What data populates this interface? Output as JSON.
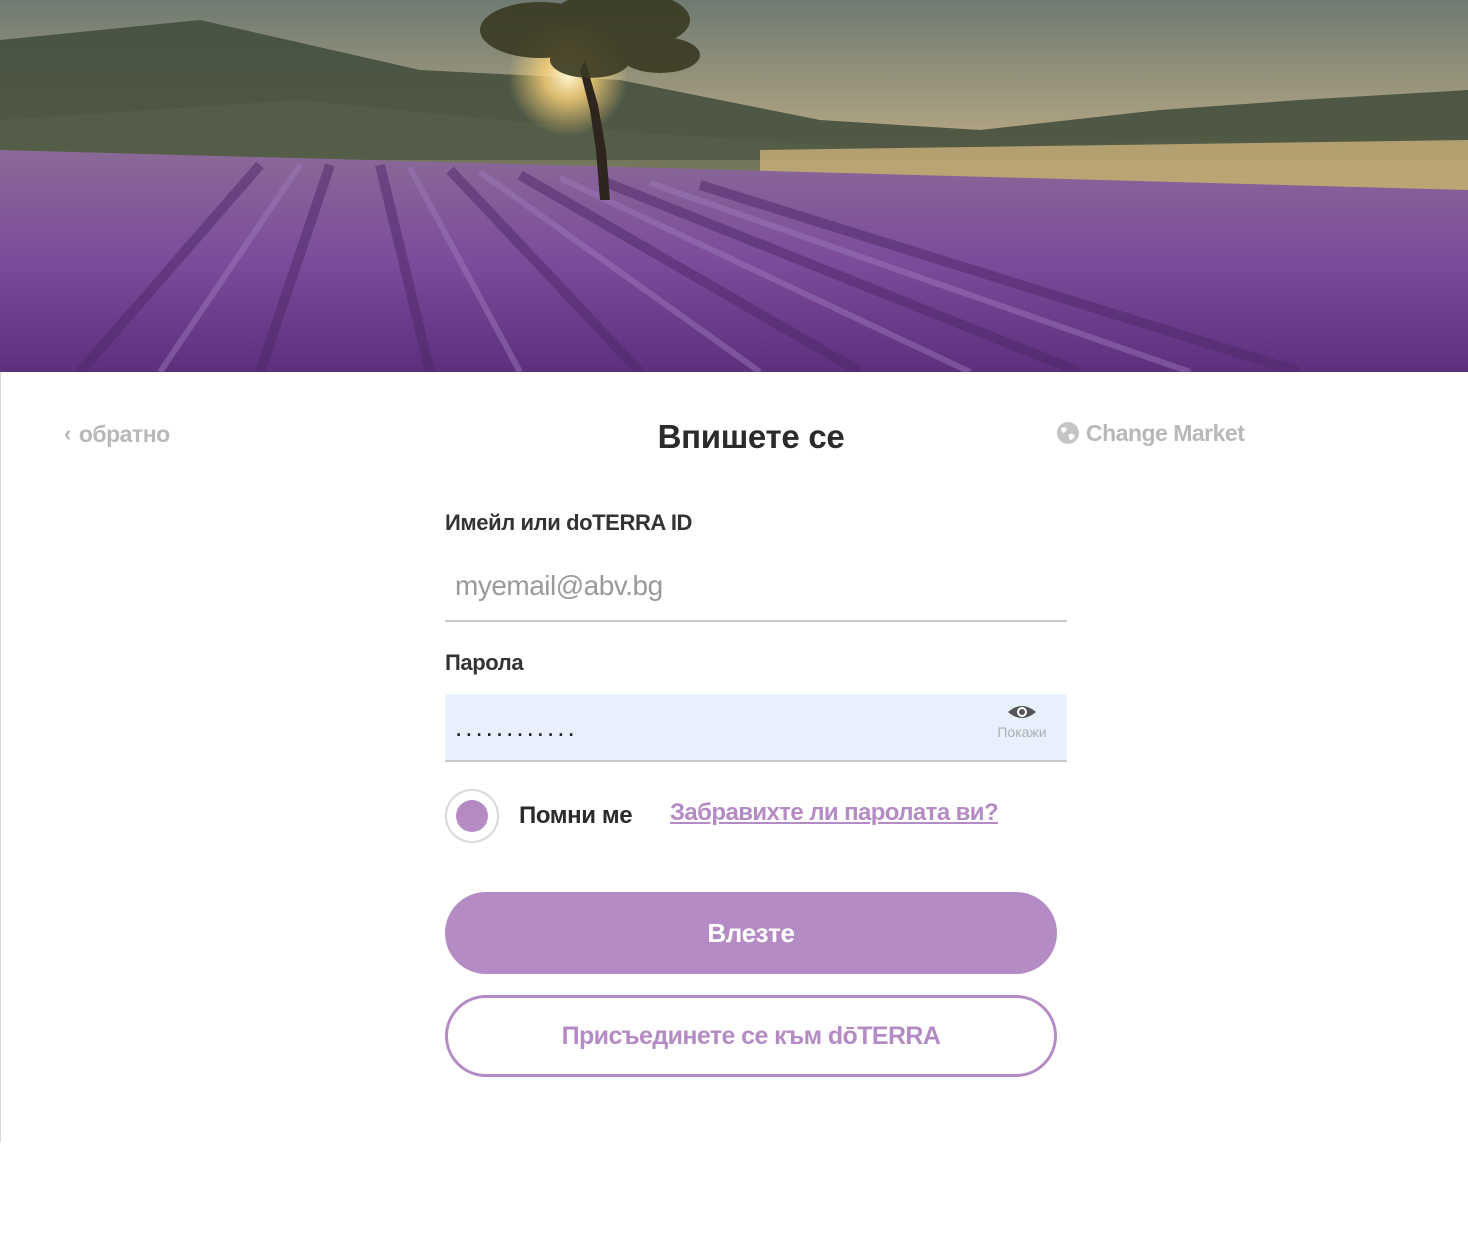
{
  "header": {
    "back_label": "обратно",
    "title": "Впишете се",
    "change_market_label": "Change Market"
  },
  "form": {
    "email_label": "Имейл или doTERRA ID",
    "email_value": "myemail@abv.bg",
    "password_label": "Парола",
    "password_value": "............",
    "show_password_label": "Покажи",
    "remember_label": "Помни ме",
    "remember_checked": true,
    "forgot_link": "Забравихте ли паролата ви?",
    "login_button": "Влезте",
    "join_button": "Присъединете се към dōTERRA"
  },
  "icons": {
    "back": "chevron-left-icon",
    "market": "globe-icon",
    "show_password": "eye-icon"
  },
  "colors": {
    "accent": "#b48bc4",
    "title": "#2b2b2b",
    "muted": "#b8b8b8",
    "password_field_bg": "#e8f0fe"
  }
}
